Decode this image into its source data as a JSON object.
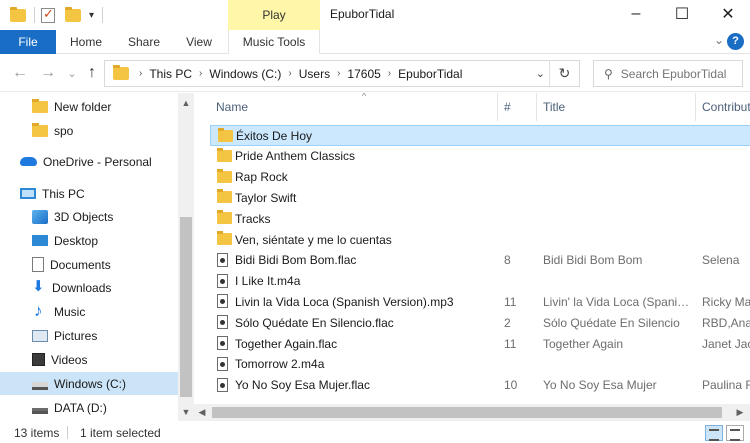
{
  "window": {
    "title": "EpuborTidal",
    "contextual_tab": "Play",
    "minimize": "–",
    "maximize": "☐",
    "close": "✕"
  },
  "ribbon": {
    "tabs": [
      "File",
      "Home",
      "Share",
      "View",
      "Music Tools"
    ],
    "expand": "⌄",
    "help": "?"
  },
  "address": {
    "back": "←",
    "forward": "→",
    "recent": "⌄",
    "up": "↑",
    "crumbs": [
      "This PC",
      "Windows (C:)",
      "Users",
      "17605",
      "EpuborTidal"
    ],
    "crumb_sep": "›",
    "dropdown": "⌄",
    "refresh": "↻"
  },
  "search": {
    "placeholder": "Search EpuborTidal"
  },
  "nav": {
    "items": [
      {
        "label": "New folder",
        "icon": "folder-icon"
      },
      {
        "label": "spo",
        "icon": "folder-icon"
      },
      {
        "label": "OneDrive - Personal",
        "icon": "cloud-icon"
      },
      {
        "label": "This PC",
        "icon": "computer-icon"
      },
      {
        "label": "3D Objects",
        "icon": "cube-icon"
      },
      {
        "label": "Desktop",
        "icon": "desktop-icon"
      },
      {
        "label": "Documents",
        "icon": "document-icon"
      },
      {
        "label": "Downloads",
        "icon": "download-icon"
      },
      {
        "label": "Music",
        "icon": "music-icon"
      },
      {
        "label": "Pictures",
        "icon": "picture-icon"
      },
      {
        "label": "Videos",
        "icon": "video-icon"
      },
      {
        "label": "Windows (C:)",
        "icon": "drive-icon",
        "selected": true
      },
      {
        "label": "DATA (D:)",
        "icon": "drive-icon"
      }
    ],
    "scroll_up": "▲",
    "scroll_down": "▼"
  },
  "list": {
    "columns": {
      "name": "Name",
      "num": "#",
      "title": "Title",
      "contrib": "Contributing artists"
    },
    "sort_indicator": "^",
    "rows": [
      {
        "name": "Éxitos De Hoy",
        "type": "folder",
        "num": "",
        "title": "",
        "contrib": "",
        "selected": true
      },
      {
        "name": "Pride Anthem Classics",
        "type": "folder",
        "num": "",
        "title": "",
        "contrib": ""
      },
      {
        "name": "Rap Rock",
        "type": "folder",
        "num": "",
        "title": "",
        "contrib": ""
      },
      {
        "name": "Taylor Swift",
        "type": "folder",
        "num": "",
        "title": "",
        "contrib": ""
      },
      {
        "name": "Tracks",
        "type": "folder",
        "num": "",
        "title": "",
        "contrib": ""
      },
      {
        "name": "Ven, siéntate y me lo cuentas",
        "type": "folder",
        "num": "",
        "title": "",
        "contrib": ""
      },
      {
        "name": "Bidi Bidi Bom Bom.flac",
        "type": "audio",
        "num": "8",
        "title": "Bidi Bidi Bom Bom",
        "contrib": "Selena"
      },
      {
        "name": "I Like It.m4a",
        "type": "audio",
        "num": "",
        "title": "",
        "contrib": ""
      },
      {
        "name": "Livin la Vida Loca (Spanish Version).mp3",
        "type": "audio",
        "num": "11",
        "title": "Livin' la Vida Loca (Spanis...",
        "contrib": "Ricky Ma"
      },
      {
        "name": "Sólo Quédate En Silencio.flac",
        "type": "audio",
        "num": "2",
        "title": "Sólo Quédate En Silencio",
        "contrib": "RBD,Anal"
      },
      {
        "name": "Together Again.flac",
        "type": "audio",
        "num": "11",
        "title": "Together Again",
        "contrib": "Janet Jack"
      },
      {
        "name": "Tomorrow 2.m4a",
        "type": "audio",
        "num": "",
        "title": "",
        "contrib": ""
      },
      {
        "name": "Yo No Soy Esa Mujer.flac",
        "type": "audio",
        "num": "10",
        "title": "Yo No Soy Esa Mujer",
        "contrib": "Paulina R"
      }
    ],
    "hscroll_left": "◀",
    "hscroll_right": "▶"
  },
  "status": {
    "count": "13 items",
    "selection": "1 item selected"
  },
  "colors": {
    "accent": "#1a6dc4",
    "selection": "#cce8ff",
    "play_tab": "#fff6a8"
  }
}
